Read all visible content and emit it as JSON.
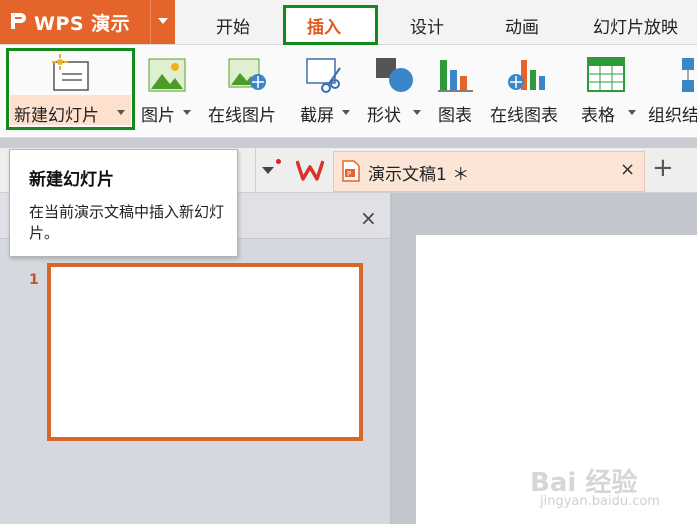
{
  "app": {
    "name": "WPS 演示"
  },
  "menu": {
    "items": [
      "开始",
      "插入",
      "设计",
      "动画",
      "幻灯片放映"
    ],
    "active": "插入"
  },
  "ribbon": {
    "new_slide": "新建幻灯片",
    "picture": "图片",
    "online_picture": "在线图片",
    "screenshot": "截屏",
    "shape": "形状",
    "chart": "图表",
    "online_chart": "在线图表",
    "table": "表格",
    "smartart": "组织结"
  },
  "tabs": {
    "doc_title": "演示文稿1 ＊",
    "close_glyph": "×",
    "add_glyph": "+"
  },
  "tooltip": {
    "title": "新建幻灯片",
    "body": "在当前演示文稿中插入新幻灯片。"
  },
  "slides_panel": {
    "close_glyph": "×",
    "slide_number": "1"
  },
  "watermark": {
    "brand": "Bai 经验",
    "url": "jingyan.baidu.com"
  },
  "colors": {
    "brand": "#e4642c",
    "highlight_box": "#118a1e",
    "thumb_border": "#d9672a",
    "active_item_bg": "#fde0cd"
  }
}
